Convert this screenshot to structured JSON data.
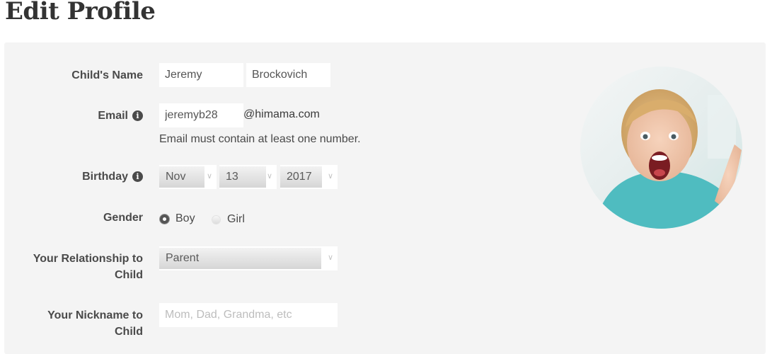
{
  "page": {
    "title": "Edit Profile"
  },
  "form": {
    "child_name": {
      "label": "Child's Name",
      "first": "Jeremy",
      "last": "Brockovich"
    },
    "email": {
      "label": "Email",
      "value": "jeremyb28",
      "domain": "@himama.com",
      "help": "Email must contain at least one number."
    },
    "birthday": {
      "label": "Birthday",
      "month": "Nov",
      "day": "13",
      "year": "2017"
    },
    "gender": {
      "label": "Gender",
      "options": [
        {
          "label": "Boy",
          "checked": true
        },
        {
          "label": "Girl",
          "checked": false
        }
      ]
    },
    "relationship": {
      "label_line1": "Your Relationship to",
      "label_line2": "Child",
      "value": "Parent"
    },
    "nickname": {
      "label_line1": "Your Nickname to",
      "label_line2": "Child",
      "placeholder": "Mom, Dad, Grandma, etc"
    }
  },
  "icons": {
    "info": "info-icon",
    "dropdown": "chevron-down-icon"
  },
  "colors": {
    "panel": "#f4f4f4",
    "title": "#333333",
    "label": "#4a4a4a"
  }
}
